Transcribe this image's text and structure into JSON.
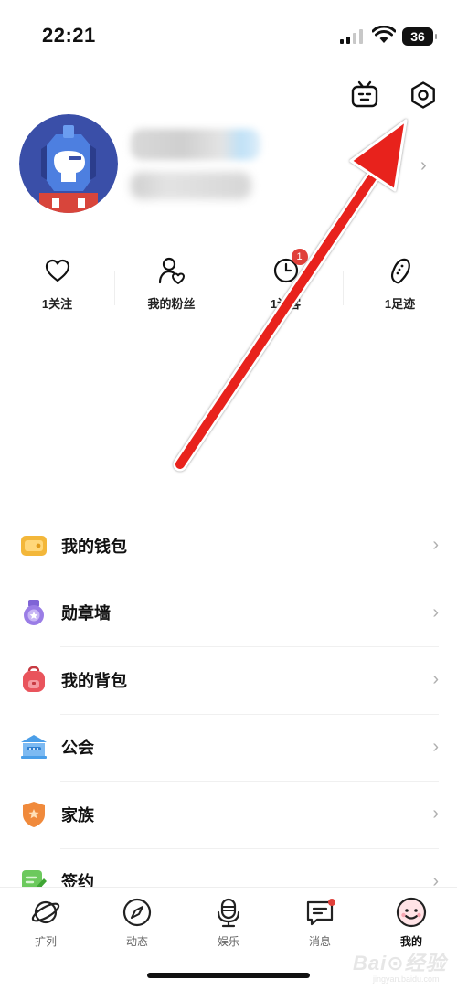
{
  "status_bar": {
    "time": "22:21",
    "battery": "36"
  },
  "header": {
    "icons": [
      "tv-icon",
      "settings-icon"
    ]
  },
  "profile": {
    "avatar_icon": "robot-avatar"
  },
  "stats": [
    {
      "label": "1关注",
      "icon": "heart-icon"
    },
    {
      "label": "我的粉丝",
      "icon": "fans-icon"
    },
    {
      "label": "1访客",
      "icon": "clock-icon",
      "badge": "1"
    },
    {
      "label": "1足迹",
      "icon": "footprint-icon"
    }
  ],
  "menu": [
    {
      "label": "我的钱包",
      "icon": "wallet-icon",
      "color": "#f3b73a"
    },
    {
      "label": "勋章墙",
      "icon": "medal-icon",
      "color": "#9a7de6"
    },
    {
      "label": "我的背包",
      "icon": "backpack-icon",
      "color": "#e9545c"
    },
    {
      "label": "公会",
      "icon": "guild-icon",
      "color": "#4a9ee8"
    },
    {
      "label": "家族",
      "icon": "family-shield-icon",
      "color": "#f08a3c"
    },
    {
      "label": "签约",
      "icon": "contract-icon",
      "color": "#6cc95d"
    }
  ],
  "tabs": [
    {
      "label": "扩列",
      "icon": "planet-icon"
    },
    {
      "label": "动态",
      "icon": "compass-icon"
    },
    {
      "label": "娱乐",
      "icon": "microphone-icon"
    },
    {
      "label": "消息",
      "icon": "message-icon"
    },
    {
      "label": "我的",
      "icon": "smiley-icon",
      "active": true
    }
  ],
  "colors": {
    "arrow": "#e8211f",
    "badge": "#e0403a"
  },
  "watermark": {
    "brand": "Bai⊙经验",
    "url": "jingyan.baidu.com"
  }
}
